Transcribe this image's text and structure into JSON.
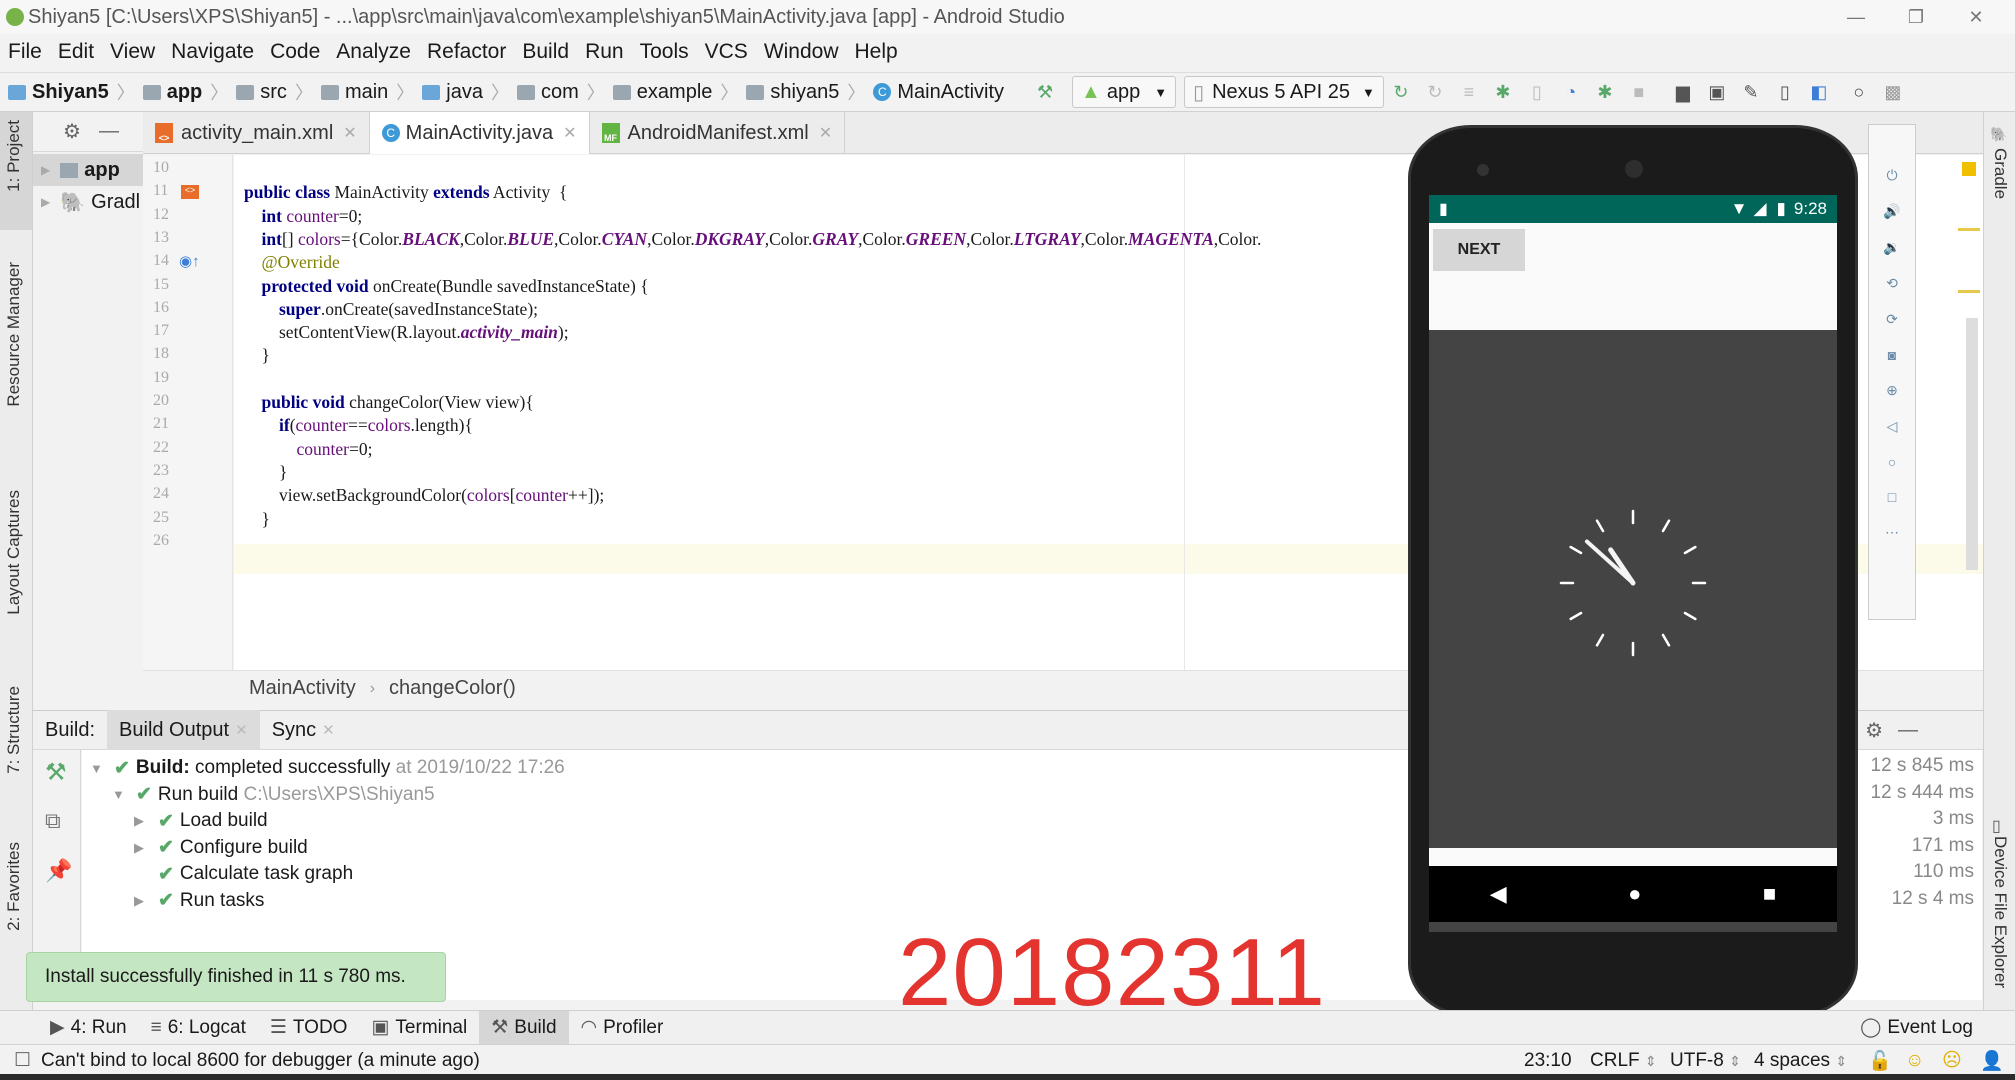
{
  "window": {
    "title": "Shiyan5 [C:\\Users\\XPS\\Shiyan5] - ...\\app\\src\\main\\java\\com\\example\\shiyan5\\MainActivity.java [app] - Android Studio"
  },
  "menu": [
    "File",
    "Edit",
    "View",
    "Navigate",
    "Code",
    "Analyze",
    "Refactor",
    "Build",
    "Run",
    "Tools",
    "VCS",
    "Window",
    "Help"
  ],
  "breadcrumb": [
    "Shiyan5",
    "app",
    "src",
    "main",
    "java",
    "com",
    "example",
    "shiyan5",
    "MainActivity"
  ],
  "toolbar": {
    "run_config": "app",
    "device": "Nexus 5 API 25"
  },
  "left_tabs": [
    "1: Project",
    "Resource Manager",
    "Layout Captures",
    "7: Structure",
    "2: Favorites"
  ],
  "right_tabs": [
    "Gradle",
    "Device File Explorer"
  ],
  "project_tree": [
    "app",
    "Gradl"
  ],
  "editor_tabs": [
    {
      "label": "activity_main.xml",
      "icon": "xml-file-icon",
      "active": false
    },
    {
      "label": "MainActivity.java",
      "icon": "java-class-icon",
      "active": true
    },
    {
      "label": "AndroidManifest.xml",
      "icon": "manifest-file-icon",
      "active": false
    }
  ],
  "code": {
    "line_numbers": [
      "10",
      "11",
      "12",
      "13",
      "14",
      "15",
      "16",
      "17",
      "18",
      "19",
      "20",
      "21",
      "22",
      "23",
      "24",
      "25",
      "26"
    ],
    "lines": [
      "",
      "public class MainActivity extends Activity  {",
      "    int counter=0;",
      "    int[] colors={Color.BLACK,Color.BLUE,Color.CYAN,Color.DKGRAY,Color.GRAY,Color.GREEN,Color.LTGRAY,Color.MAGENTA,Color.",
      "    @Override",
      "    protected void onCreate(Bundle savedInstanceState) {",
      "        super.onCreate(savedInstanceState);",
      "        setContentView(R.layout.activity_main);",
      "    }",
      "",
      "    public void changeColor(View view){",
      "        if(counter==colors.length){",
      "            counter=0;",
      "        }",
      "        view.setBackgroundColor(colors[counter++]);",
      "    }",
      ""
    ]
  },
  "editor_breadcrumb": [
    "MainActivity",
    "changeColor()"
  ],
  "build": {
    "label": "Build:",
    "tabs": [
      "Build Output",
      "Sync"
    ],
    "rows": [
      {
        "bold": "Build:",
        "text": " completed successfully",
        "dim": " at 2019/10/22 17:26",
        "duration": "12 s 845 ms"
      },
      {
        "bold": "",
        "text": "Run build",
        "dim": " C:\\Users\\XPS\\Shiyan5",
        "duration": "12 s 444 ms"
      },
      {
        "bold": "",
        "text": "Load build",
        "dim": "",
        "duration": "3 ms"
      },
      {
        "bold": "",
        "text": "Configure build",
        "dim": "",
        "duration": "171 ms"
      },
      {
        "bold": "",
        "text": "Calculate task graph",
        "dim": "",
        "duration": "110 ms"
      },
      {
        "bold": "",
        "text": "Run tasks",
        "dim": "",
        "duration": "12 s 4 ms"
      }
    ]
  },
  "toast": "Install successfully finished in 11 s 780 ms.",
  "stamp": "20182311",
  "bottom_tabs": [
    "4: Run",
    "6: Logcat",
    "TODO",
    "Terminal",
    "Build",
    "Profiler"
  ],
  "event_log": "Event Log",
  "status": {
    "message": "Can't bind to local 8600 for debugger (a minute ago)",
    "position": "23:10",
    "line_sep": "CRLF",
    "encoding": "UTF-8",
    "indent": "4 spaces"
  },
  "emulator": {
    "time": "9:28",
    "button": "NEXT",
    "statusbar_color": "#00665a",
    "background_color": "#444444",
    "clock_time": "10:52"
  }
}
